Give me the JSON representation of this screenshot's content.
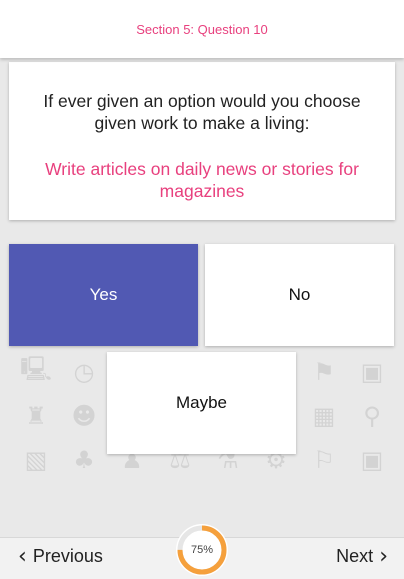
{
  "header": {
    "title": "Section 5: Question 10"
  },
  "question": {
    "text": "If ever given an option would you choose given work to make a living:",
    "option": "Write articles on daily news or stories for magazines"
  },
  "answers": {
    "yes": {
      "label": "Yes",
      "selected": true
    },
    "no": {
      "label": "No",
      "selected": false
    },
    "maybe": {
      "label": "Maybe",
      "selected": false
    }
  },
  "footer": {
    "previous_label": "Previous",
    "next_label": "Next",
    "progress_value": 75,
    "progress_label": "75%"
  },
  "colors": {
    "accent_pink": "#e8407e",
    "selected_blue": "#5159b3",
    "progress_orange": "#f5a03c"
  },
  "icons": {
    "previous": "chevron-left-icon",
    "next": "chevron-right-icon"
  }
}
